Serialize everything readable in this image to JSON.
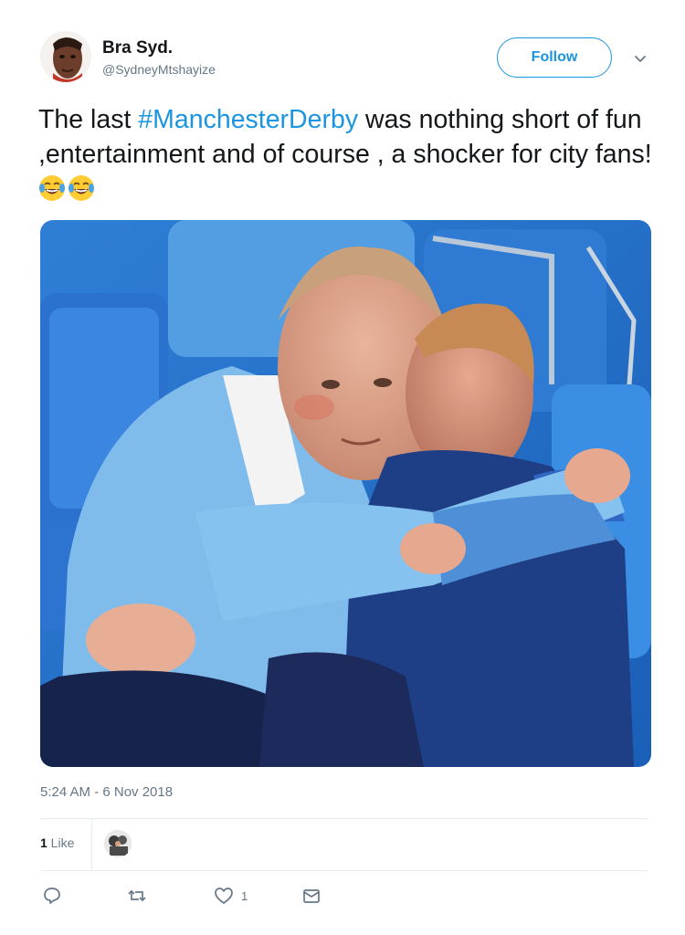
{
  "tweet": {
    "author_name": "Bra Syd.",
    "author_handle": "@SydneyMtshayize",
    "follow_label": "Follow",
    "text_part1": "The last ",
    "hashtag": "#ManchesterDerby",
    "text_part2": " was nothing short of fun ,entertainment and of course , a shocker for city fans!",
    "emojis": [
      "face-with-tears-of-joy",
      "face-with-tears-of-joy"
    ],
    "timestamp": "5:24 AM - 6 Nov 2018",
    "likes_number": "1",
    "likes_label": " Like",
    "like_action_count": "1"
  },
  "icons": {
    "chevron": "chevron-down-icon",
    "reply": "reply-icon",
    "retweet": "retweet-icon",
    "like": "heart-icon",
    "message": "envelope-icon"
  },
  "colors": {
    "link": "#1b95e0",
    "secondary_text": "#657786",
    "primary_text": "#14171a"
  }
}
